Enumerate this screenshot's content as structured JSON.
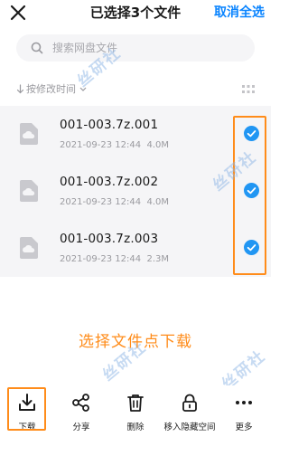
{
  "header": {
    "title": "已选择3个文件",
    "cancel_all": "取消全选"
  },
  "search": {
    "placeholder": "搜索网盘文件"
  },
  "sort": {
    "label": "按修改时间"
  },
  "files": [
    {
      "name": "001-003.7z.001",
      "date": "2021-09-23 12:44",
      "size": "4.0M",
      "selected": true
    },
    {
      "name": "001-003.7z.002",
      "date": "2021-09-23 12:44",
      "size": "4.0M",
      "selected": true
    },
    {
      "name": "001-003.7z.003",
      "date": "2021-09-23 12:44",
      "size": "2.3M",
      "selected": true
    }
  ],
  "hint": "选择文件点下载",
  "watermark": "丝研社",
  "toolbar": {
    "download": "下载",
    "share": "分享",
    "delete": "删除",
    "move_hidden": "移入隐藏空间",
    "more": "更多"
  },
  "colors": {
    "accent": "#0a84ff",
    "check": "#2196f3",
    "highlight": "#ff8c1a",
    "list_bg": "#f5f5f7"
  },
  "icons": {
    "close": "close-icon",
    "search": "search-icon",
    "sort_arrow": "arrow-down-icon",
    "sort_chevron": "chevron-down-icon",
    "view_toggle": "grid-view-icon",
    "file": "file-icon",
    "check": "check-circle-icon",
    "download": "download-icon",
    "share": "share-icon",
    "delete": "trash-icon",
    "lock": "lock-icon",
    "more": "more-icon"
  }
}
